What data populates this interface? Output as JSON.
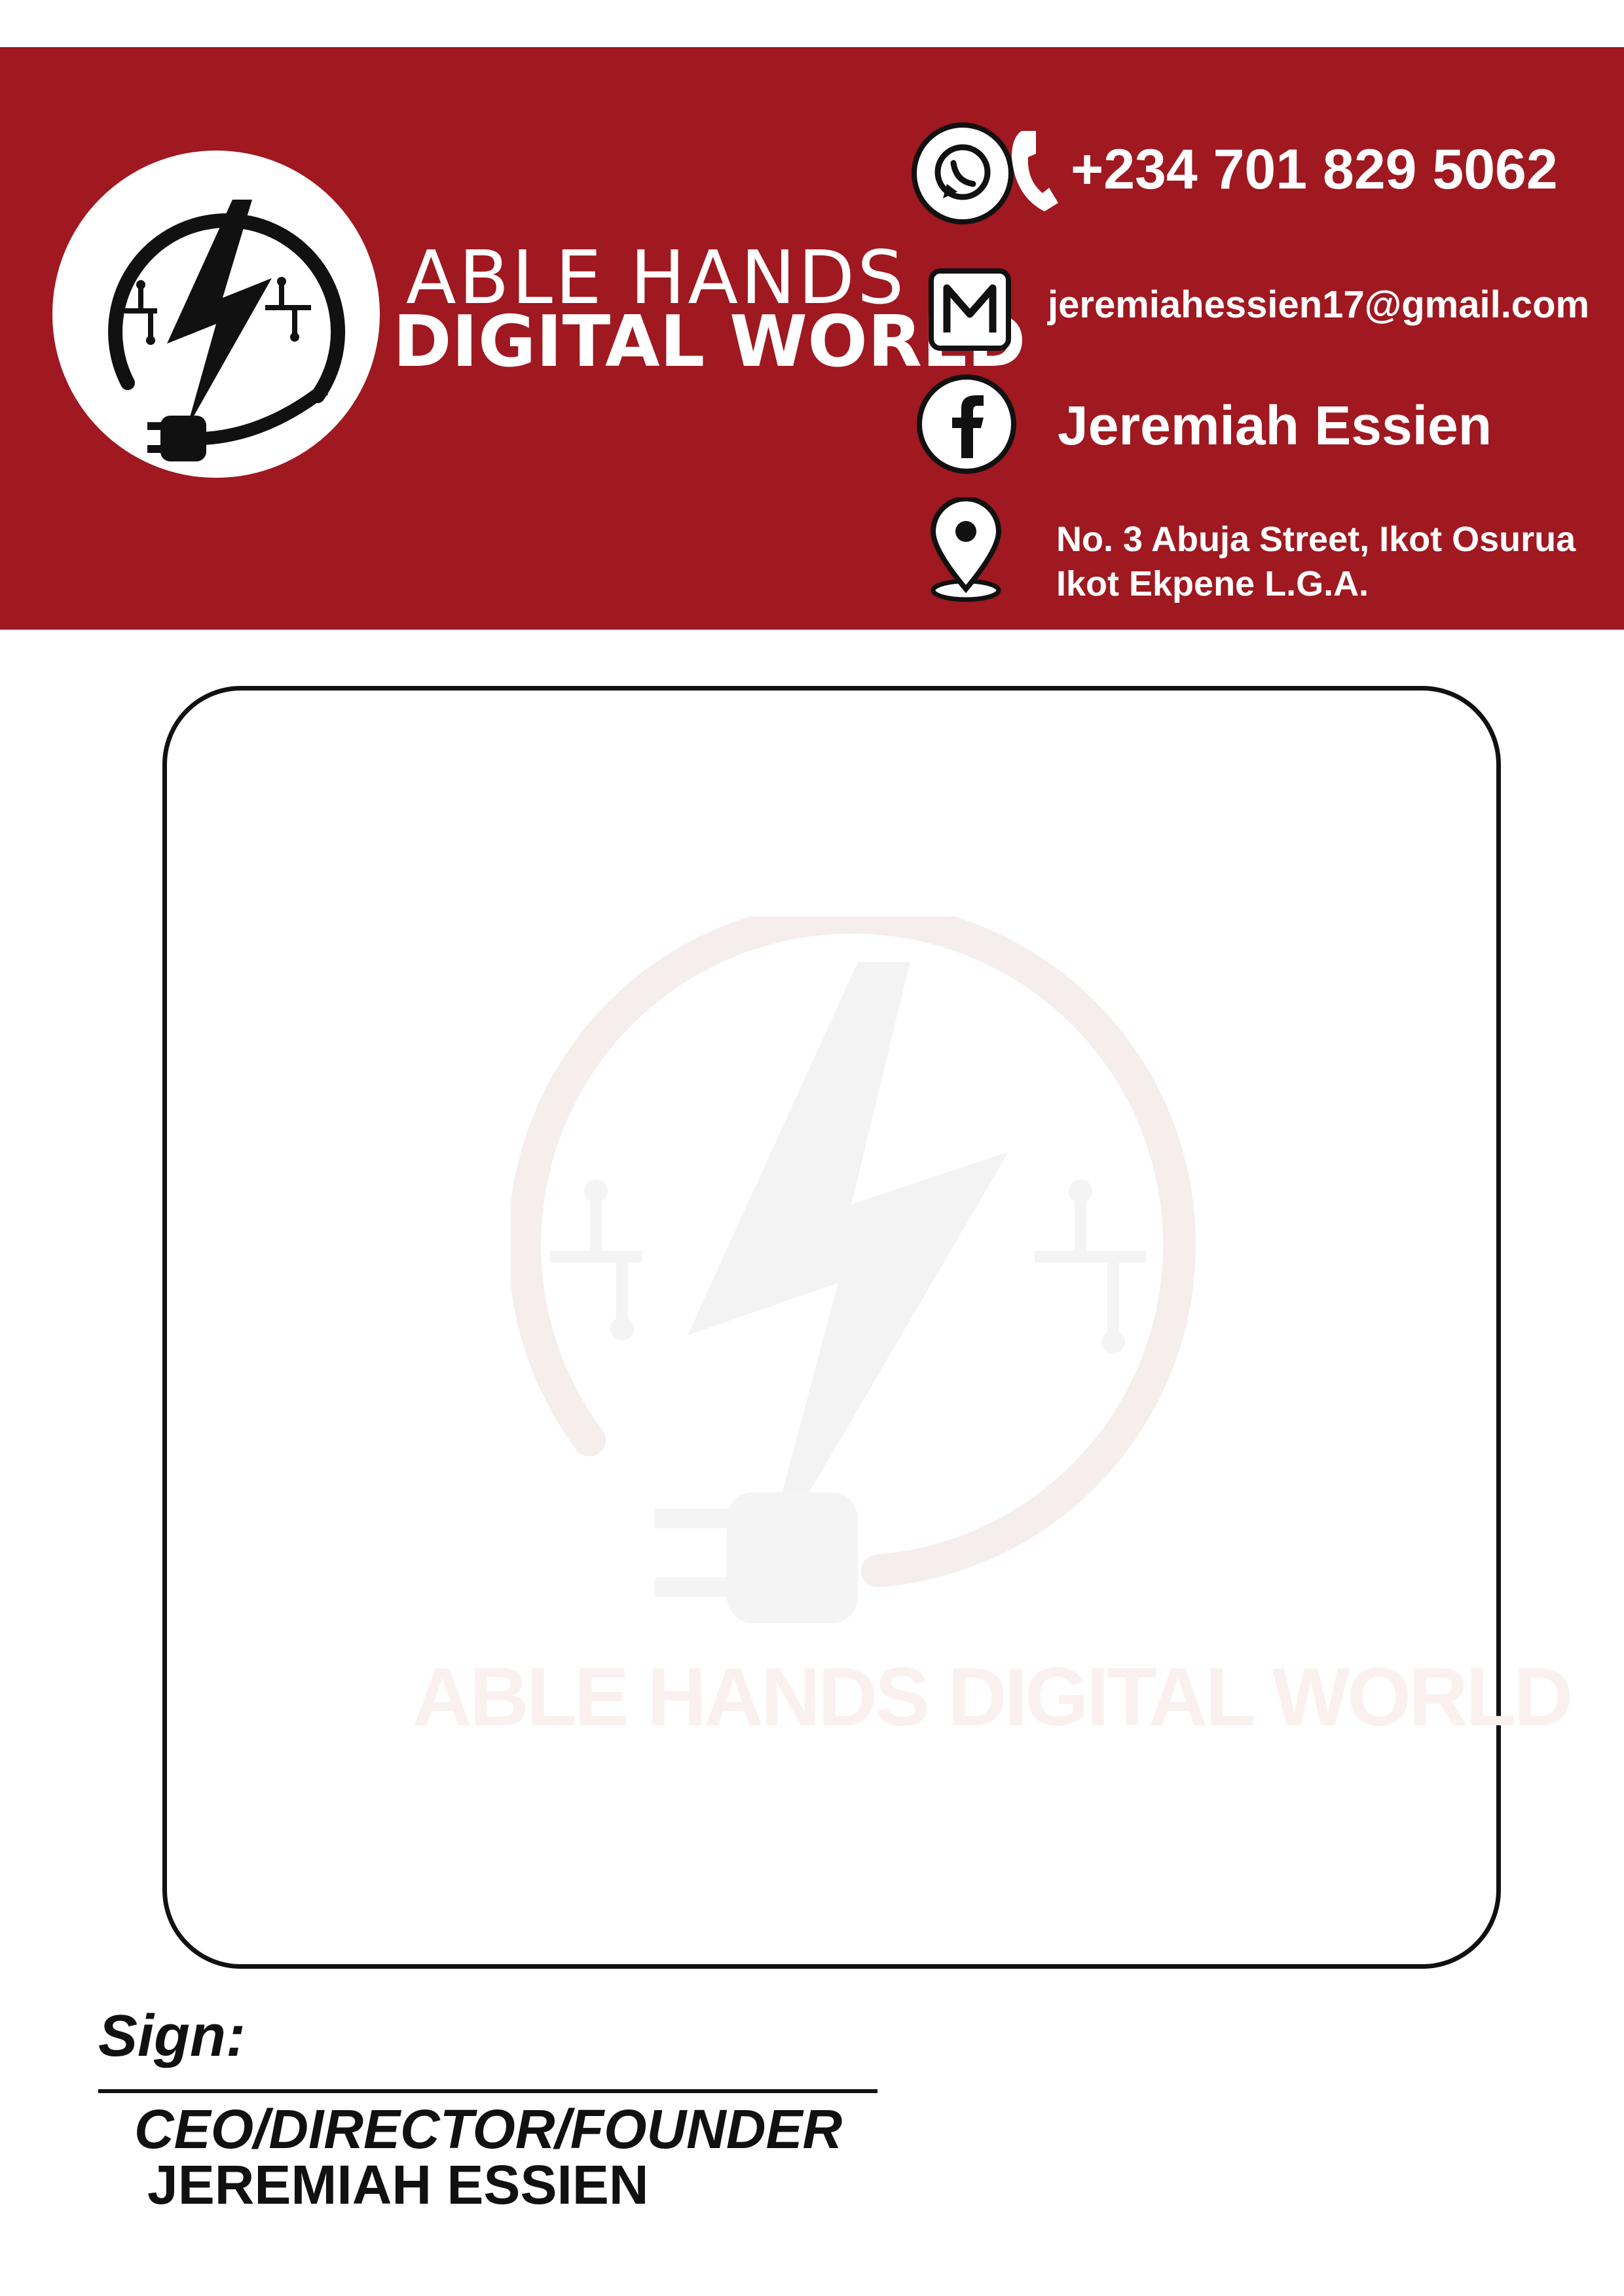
{
  "header": {
    "brand_line1": "ABLE HANDS",
    "brand_line2": "DIGITAL WORLD",
    "phone": "+234 701 829 5062",
    "email": "jeremiahessien17@gmail.com",
    "facebook": "Jeremiah Essien",
    "address_line1": "No. 3 Abuja Street, Ikot Osurua",
    "address_line2": "Ikot Ekpene L.G.A.",
    "icons": [
      "logo-icon",
      "whatsapp-icon",
      "phone-icon",
      "mail-icon",
      "facebook-icon",
      "location-pin-icon"
    ],
    "colors": {
      "brand_red": "#a01820",
      "text": "#ffffff"
    }
  },
  "watermark": {
    "text": "ABLE HANDS DIGITAL WORLD"
  },
  "footer": {
    "sign_label": "Sign:",
    "role": "CEO/DIRECTOR/FOUNDER",
    "name": "JEREMIAH ESSIEN"
  }
}
